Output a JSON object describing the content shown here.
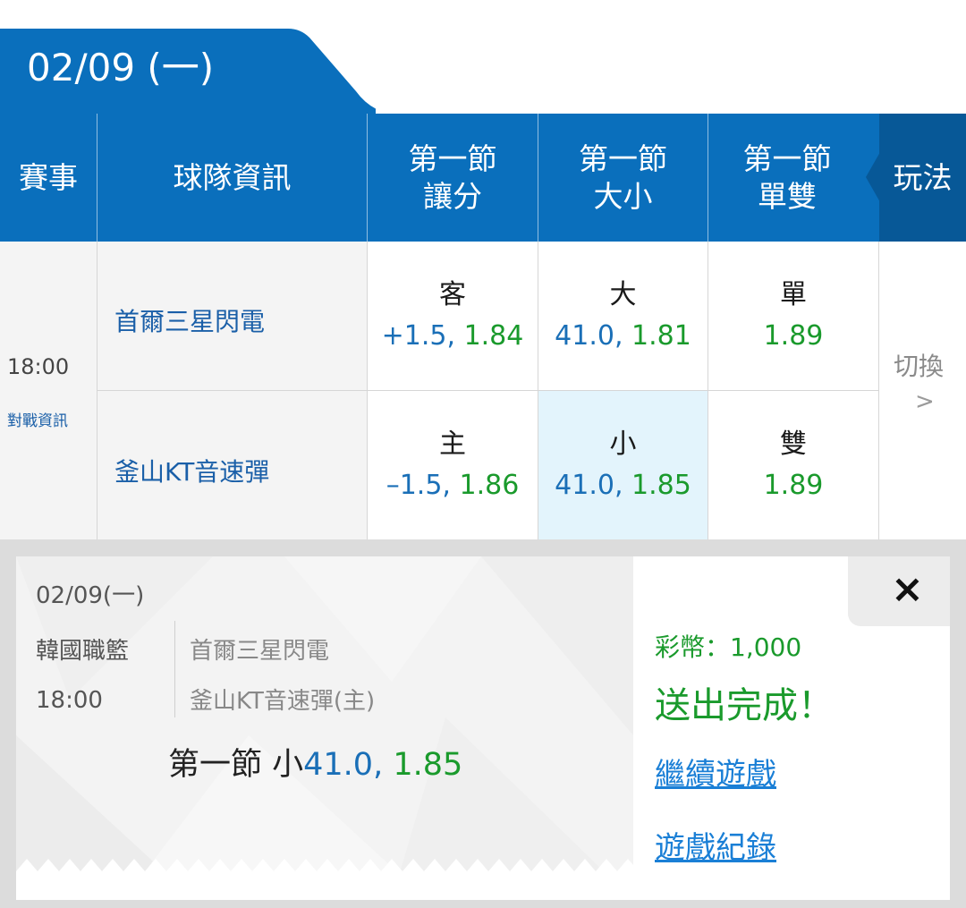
{
  "date": "02/09 (一)",
  "header": {
    "event": "賽事",
    "team_info": "球隊資訊",
    "col1_line1": "第一節",
    "col1_line2": "讓分",
    "col2_line1": "第一節",
    "col2_line2": "大小",
    "col3_line1": "第一節",
    "col3_line2": "單雙",
    "play": "玩法"
  },
  "match": {
    "time": "18:00",
    "info_link": "對戰資訊",
    "home_team": "首爾三星閃電",
    "away_team": "釜山KT音速彈",
    "switch_label": "切換",
    "switch_arrow": ">"
  },
  "odds": {
    "row1": {
      "spread_label": "客",
      "spread_line": "+1.5,",
      "spread_odds": "1.84",
      "total_label": "大",
      "total_line": "41.0,",
      "total_odds": "1.81",
      "oddeven_label": "單",
      "oddeven_odds": "1.89"
    },
    "row2": {
      "spread_label": "主",
      "spread_line": "–1.5,",
      "spread_odds": "1.86",
      "total_label": "小",
      "total_line": "41.0,",
      "total_odds": "1.85",
      "oddeven_label": "雙",
      "oddeven_odds": "1.89"
    }
  },
  "ticket": {
    "date": "02/09(一)",
    "league": "韓國職籃",
    "time": "18:00",
    "team1": "首爾三星閃電",
    "team2": "釜山KT音速彈(主)",
    "bet_prefix": "第一節 小",
    "bet_line": "41.0,",
    "bet_odds": "1.85",
    "coins": "彩幣：1,000",
    "sent": "送出完成！",
    "continue": "繼續遊戲",
    "history": "遊戲紀錄",
    "close": "×"
  },
  "colors": {
    "header_blue": "#0a6fbc",
    "header_dark": "#075897",
    "odds_blue": "#1a6fb7",
    "odds_green": "#1a9a2c",
    "selected_bg": "#e3f4fc",
    "link": "#1a7fd6"
  }
}
